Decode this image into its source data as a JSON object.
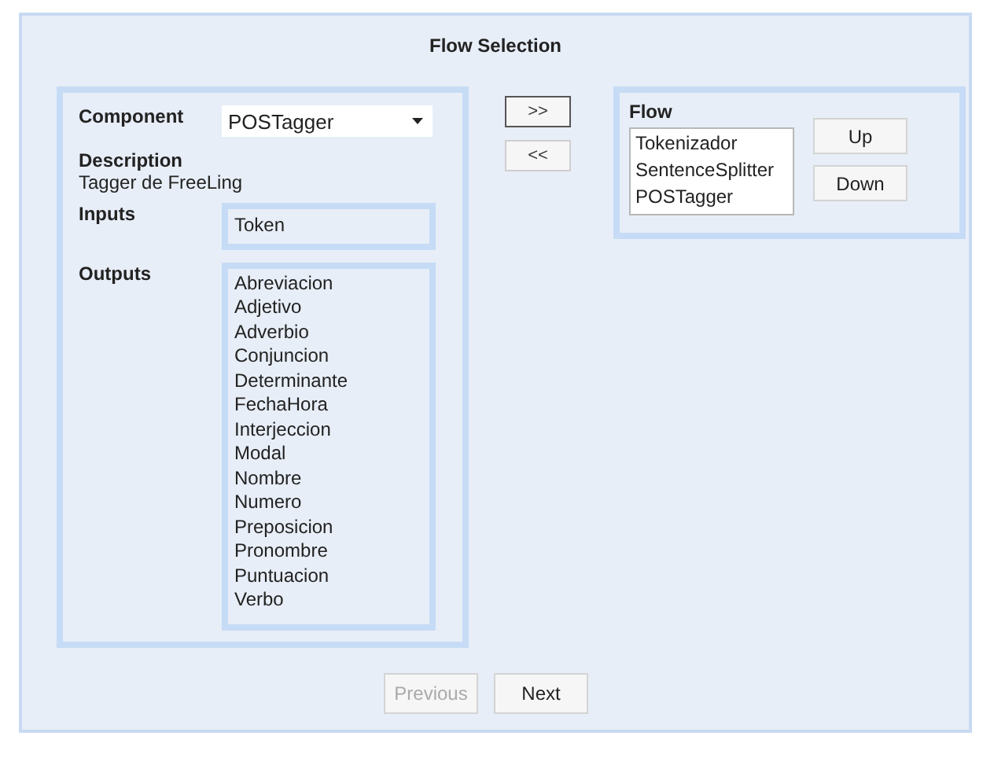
{
  "title": "Flow Selection",
  "component": {
    "label": "Component",
    "value": "POSTagger"
  },
  "description": {
    "label": "Description",
    "text": "Tagger de FreeLing"
  },
  "inputs": {
    "label": "Inputs",
    "items": [
      "Token"
    ]
  },
  "outputs": {
    "label": "Outputs",
    "items": [
      "Abreviacion",
      "Adjetivo",
      "Adverbio",
      "Conjuncion",
      "Determinante",
      "FechaHora",
      "Interjeccion",
      "Modal",
      "Nombre",
      "Numero",
      "Preposicion",
      "Pronombre",
      "Puntuacion",
      "Verbo"
    ]
  },
  "move_buttons": [
    {
      "label": ">>",
      "focused": true
    },
    {
      "label": "<<",
      "focused": false
    }
  ],
  "flow": {
    "label": "Flow",
    "items": [
      {
        "label": "Tokenizador",
        "selected": false
      },
      {
        "label": "SentenceSplitter",
        "selected": false
      },
      {
        "label": "POSTagger",
        "selected": false
      }
    ],
    "buttons": [
      "Up",
      "Down"
    ]
  },
  "nav_buttons": [
    {
      "label": "Previous",
      "disabled": true
    },
    {
      "label": "Next",
      "disabled": false
    }
  ]
}
